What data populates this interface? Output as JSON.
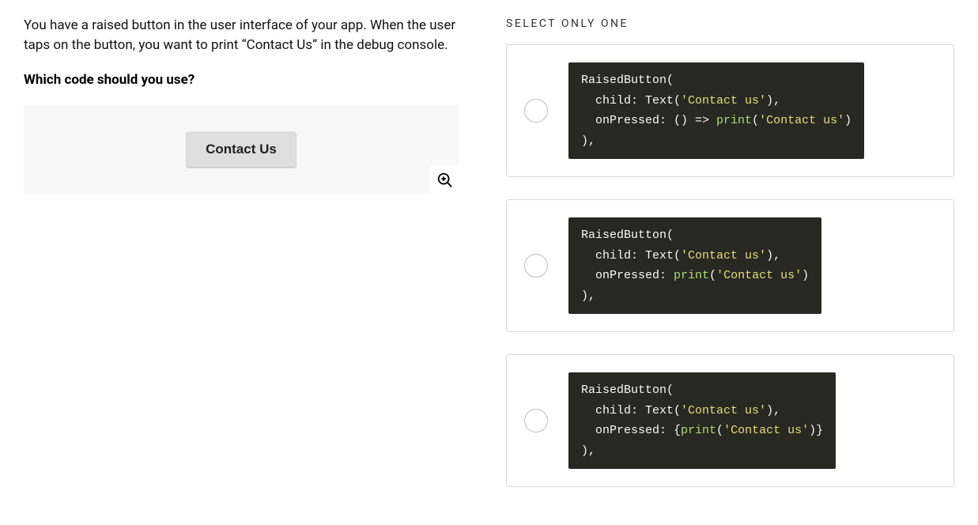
{
  "question": {
    "description": "You have a raised button in the user interface of your app. When the user taps on the button, you want to print “Contact Us” in the debug console.",
    "prompt": "Which code should you use?",
    "preview_button_label": "Contact Us"
  },
  "answer_section": {
    "label": "SELECT ONLY ONE",
    "options": [
      {
        "id": "opt-a",
        "code_lines": [
          [
            {
              "t": "RaisedButton(",
              "c": "kw"
            }
          ],
          [
            {
              "t": "  child: Text(",
              "c": "kw"
            },
            {
              "t": "'Contact us'",
              "c": "str"
            },
            {
              "t": "),",
              "c": "kw"
            }
          ],
          [
            {
              "t": "  onPressed: () => ",
              "c": "kw"
            },
            {
              "t": "print",
              "c": "fn"
            },
            {
              "t": "(",
              "c": "kw"
            },
            {
              "t": "'Contact us'",
              "c": "str"
            },
            {
              "t": ")",
              "c": "kw"
            }
          ],
          [
            {
              "t": "),",
              "c": "kw"
            }
          ]
        ]
      },
      {
        "id": "opt-b",
        "code_lines": [
          [
            {
              "t": "RaisedButton(",
              "c": "kw"
            }
          ],
          [
            {
              "t": "  child: Text(",
              "c": "kw"
            },
            {
              "t": "'Contact us'",
              "c": "str"
            },
            {
              "t": "),",
              "c": "kw"
            }
          ],
          [
            {
              "t": "  onPressed: ",
              "c": "kw"
            },
            {
              "t": "print",
              "c": "fn"
            },
            {
              "t": "(",
              "c": "kw"
            },
            {
              "t": "'Contact us'",
              "c": "str"
            },
            {
              "t": ")",
              "c": "kw"
            }
          ],
          [
            {
              "t": "),",
              "c": "kw"
            }
          ]
        ]
      },
      {
        "id": "opt-c",
        "code_lines": [
          [
            {
              "t": "RaisedButton(",
              "c": "kw"
            }
          ],
          [
            {
              "t": "  child: Text(",
              "c": "kw"
            },
            {
              "t": "'Contact us'",
              "c": "str"
            },
            {
              "t": "),",
              "c": "kw"
            }
          ],
          [
            {
              "t": "  onPressed: {",
              "c": "kw"
            },
            {
              "t": "print",
              "c": "fn"
            },
            {
              "t": "(",
              "c": "kw"
            },
            {
              "t": "'Contact us'",
              "c": "str"
            },
            {
              "t": ")}",
              "c": "kw"
            }
          ],
          [
            {
              "t": "),",
              "c": "kw"
            }
          ]
        ]
      }
    ]
  }
}
